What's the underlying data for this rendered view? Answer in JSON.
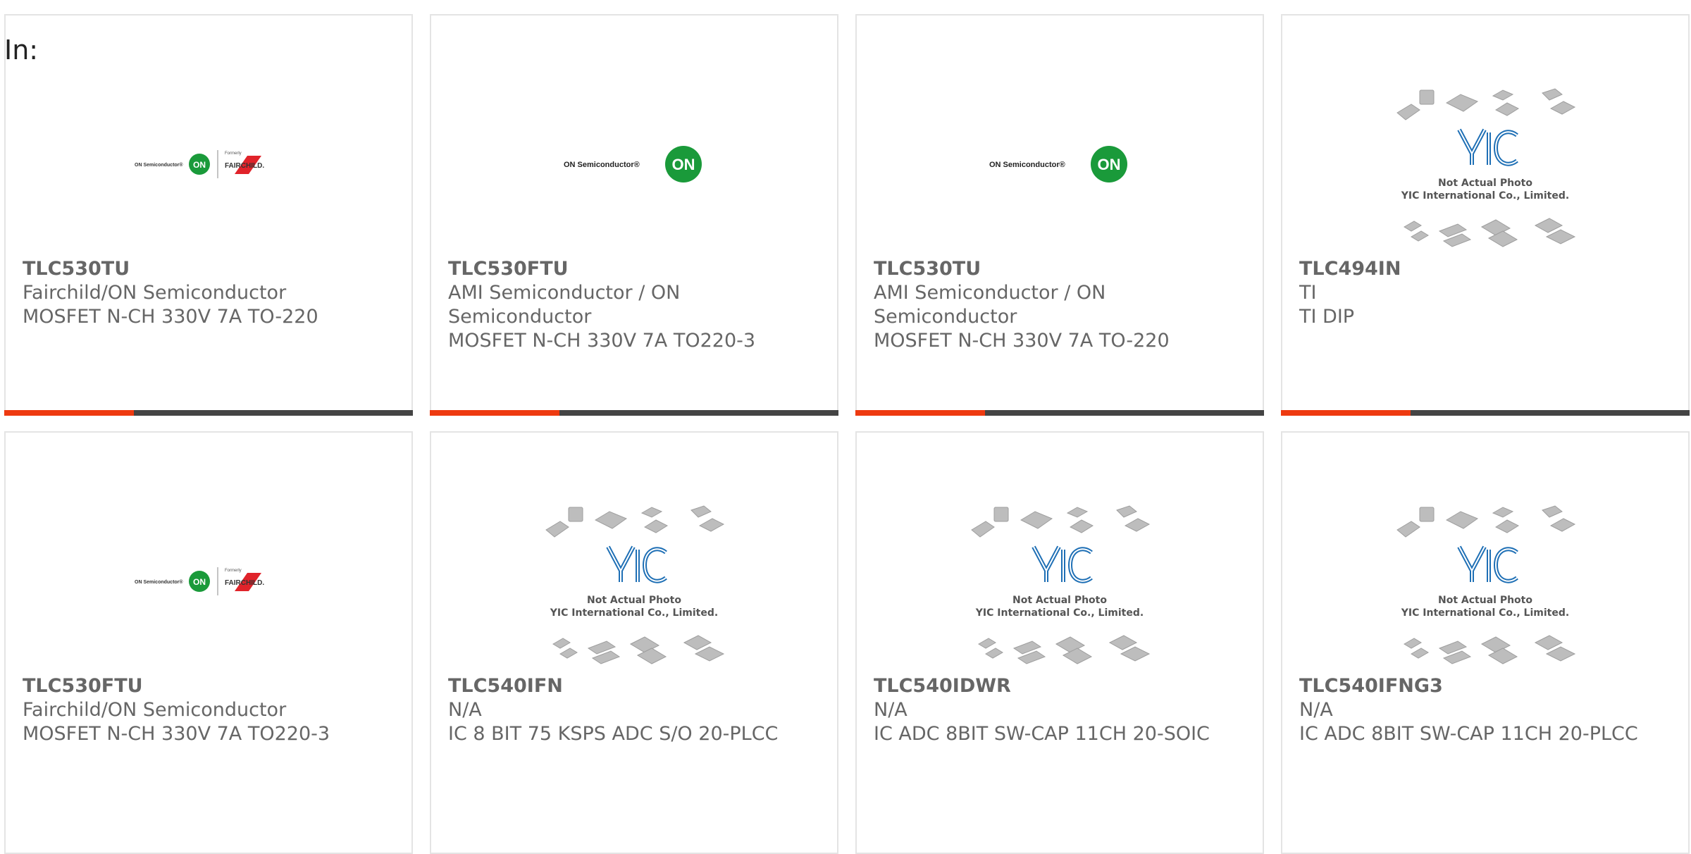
{
  "header": {
    "label": "In:"
  },
  "colors": {
    "accent": "#ee3a10",
    "bar": "#444444",
    "on_green": "#1a9a3a",
    "yic_blue": "#1e6fb5"
  },
  "products": [
    {
      "part": "TLC530TU",
      "manufacturer": "Fairchild/ON Semiconductor",
      "description": "MOSFET N-CH 330V 7A TO-220",
      "image": "fairchild-on-logo",
      "logo_text": {
        "on": "ON Semiconductor®",
        "on_mark": "ON",
        "formerly": "Formerly",
        "fairchild": "FAIRCHILD."
      }
    },
    {
      "part": "TLC530FTU",
      "manufacturer": "AMI Semiconductor / ON Semiconductor",
      "description": "MOSFET N-CH 330V 7A TO220-3",
      "image": "on-semiconductor-logo",
      "logo_text": {
        "on": "ON Semiconductor®",
        "on_mark": "ON"
      }
    },
    {
      "part": "TLC530TU",
      "manufacturer": "AMI Semiconductor / ON Semiconductor",
      "description": "MOSFET N-CH 330V 7A TO-220",
      "image": "on-semiconductor-logo",
      "logo_text": {
        "on": "ON Semiconductor®",
        "on_mark": "ON"
      }
    },
    {
      "part": "TLC494IN",
      "manufacturer": "TI",
      "description": "TI DIP",
      "image": "yic-placeholder",
      "logo_text": {
        "line1": "Not Actual Photo",
        "line2": "YIC International Co., Limited."
      }
    },
    {
      "part": "TLC530FTU",
      "manufacturer": "Fairchild/ON Semiconductor",
      "description": "MOSFET N-CH 330V 7A TO220-3",
      "image": "fairchild-on-logo",
      "logo_text": {
        "on": "ON Semiconductor®",
        "on_mark": "ON",
        "formerly": "Formerly",
        "fairchild": "FAIRCHILD."
      }
    },
    {
      "part": "TLC540IFN",
      "manufacturer": "N/A",
      "description": "IC 8 BIT 75 KSPS ADC S/O 20-PLCC",
      "image": "yic-placeholder",
      "logo_text": {
        "line1": "Not Actual Photo",
        "line2": "YIC International Co., Limited."
      }
    },
    {
      "part": "TLC540IDWR",
      "manufacturer": "N/A",
      "description": "IC ADC 8BIT SW-CAP 11CH 20-SOIC",
      "image": "yic-placeholder",
      "logo_text": {
        "line1": "Not Actual Photo",
        "line2": "YIC International Co., Limited."
      }
    },
    {
      "part": "TLC540IFNG3",
      "manufacturer": "N/A",
      "description": "IC ADC 8BIT SW-CAP 11CH 20-PLCC",
      "image": "yic-placeholder",
      "logo_text": {
        "line1": "Not Actual Photo",
        "line2": "YIC International Co., Limited."
      }
    }
  ]
}
